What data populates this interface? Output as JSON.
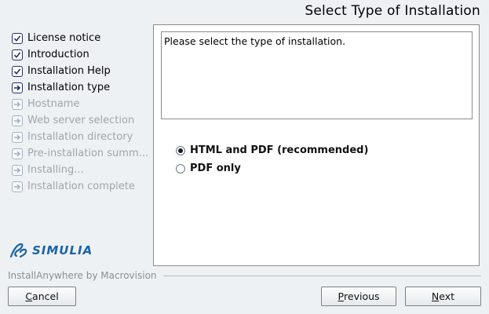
{
  "header": {
    "title": "Select Type of Installation"
  },
  "steps": [
    {
      "label": "License notice",
      "state": "done"
    },
    {
      "label": "Introduction",
      "state": "done"
    },
    {
      "label": "Installation Help",
      "state": "done"
    },
    {
      "label": "Installation type",
      "state": "current"
    },
    {
      "label": "Hostname",
      "state": "future"
    },
    {
      "label": "Web server selection",
      "state": "future"
    },
    {
      "label": "Installation directory",
      "state": "future"
    },
    {
      "label": "Pre-installation summ...",
      "state": "future"
    },
    {
      "label": "Installing...",
      "state": "future"
    },
    {
      "label": "Installation complete",
      "state": "future"
    }
  ],
  "brand": {
    "name": "SIMULIA",
    "color": "#1a63a8"
  },
  "panel": {
    "message": "Please select the type of installation.",
    "options": [
      {
        "label": "HTML and PDF (recommended)",
        "selected": true
      },
      {
        "label": "PDF only",
        "selected": false
      }
    ]
  },
  "footer": {
    "vendor": "InstallAnywhere by Macrovision",
    "cancel": {
      "mnemonic": "C",
      "rest": "ancel"
    },
    "previous": {
      "mnemonic": "P",
      "rest": "revious"
    },
    "next": {
      "mnemonic": "N",
      "rest": "ext"
    }
  },
  "colors": {
    "background": "#eef1f4",
    "icon_border": "#1e2f66",
    "disabled_text": "#a0a4aa"
  }
}
